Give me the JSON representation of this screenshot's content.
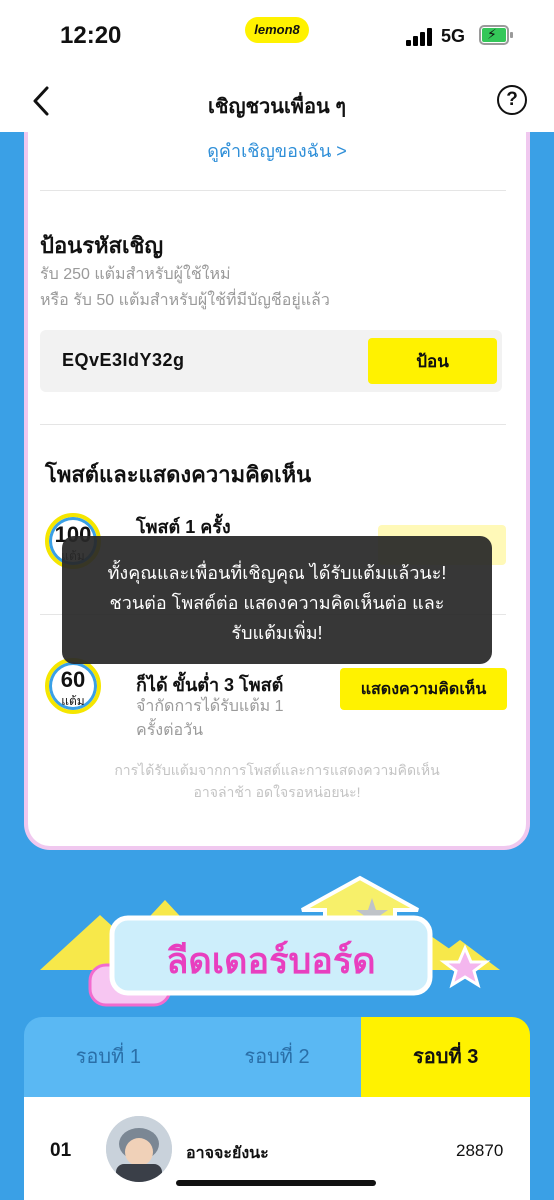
{
  "status_bar": {
    "time": "12:20",
    "app_logo": "lemon8",
    "network": "5G",
    "icons": [
      "signal-icon",
      "battery-icon"
    ]
  },
  "nav": {
    "title": "เชิญชวนเพื่อน ๆ",
    "back_icon": "chevron-left-icon",
    "help_icon": "question-circle-icon",
    "help_glyph": "?"
  },
  "card": {
    "view_invites_link": "ดูคำเชิญของฉัน >",
    "invite_section": {
      "heading": "ป้อนรหัสเชิญ",
      "subtitle_line1": "รับ 250 แต้มสำหรับผู้ใช้ใหม่",
      "subtitle_line2": "หรือ รับ 50 แต้มสำหรับผู้ใช้ที่มีบัญชีอยู่แล้ว",
      "code_value": "EQvE3IdY32g",
      "enter_button": "ป้อน"
    },
    "post_section": {
      "heading": "โพสต์และแสดงความคิดเห็น",
      "task1": {
        "points": "100",
        "points_unit": "แต้ม",
        "title": "โพสต์ 1 ครั้ง"
      },
      "task2": {
        "points": "60",
        "points_unit": "แต้ม",
        "title": "ก็ได้ ขั้นต่ำ 3 โพสต์",
        "desc_line1": "จำกัดการได้รับแต้ม 1",
        "desc_line2": "ครั้งต่อวัน",
        "button": "แสดงความคิดเห็น"
      },
      "note_line1": "การได้รับแต้มจากการโพสต์และการแสดงความคิดเห็น",
      "note_line2": "อาจล่าช้า อดใจรอหน่อยนะ!"
    }
  },
  "toast": {
    "line1": "ทั้งคุณและเพื่อนที่เชิญคุณ ได้รับแต้มแล้วนะ!",
    "line2": "ชวนต่อ โพสต์ต่อ แสดงความคิดเห็นต่อ และ",
    "line3": "รับแต้มเพิ่ม!"
  },
  "leaderboard": {
    "banner_title": "ลีดเดอร์บอร์ด",
    "tabs": [
      "รอบที่ 1",
      "รอบที่ 2",
      "รอบที่ 3"
    ],
    "active_tab": "รอบที่ 3",
    "rows": [
      {
        "rank": "01",
        "name": "อาจจะยังนะ",
        "score": "28870"
      }
    ]
  },
  "colors": {
    "accent_yellow": "#fff200",
    "background_blue": "#3aa0e6",
    "link_blue": "#2f8fd8",
    "card_border": "#f0c8ef"
  }
}
